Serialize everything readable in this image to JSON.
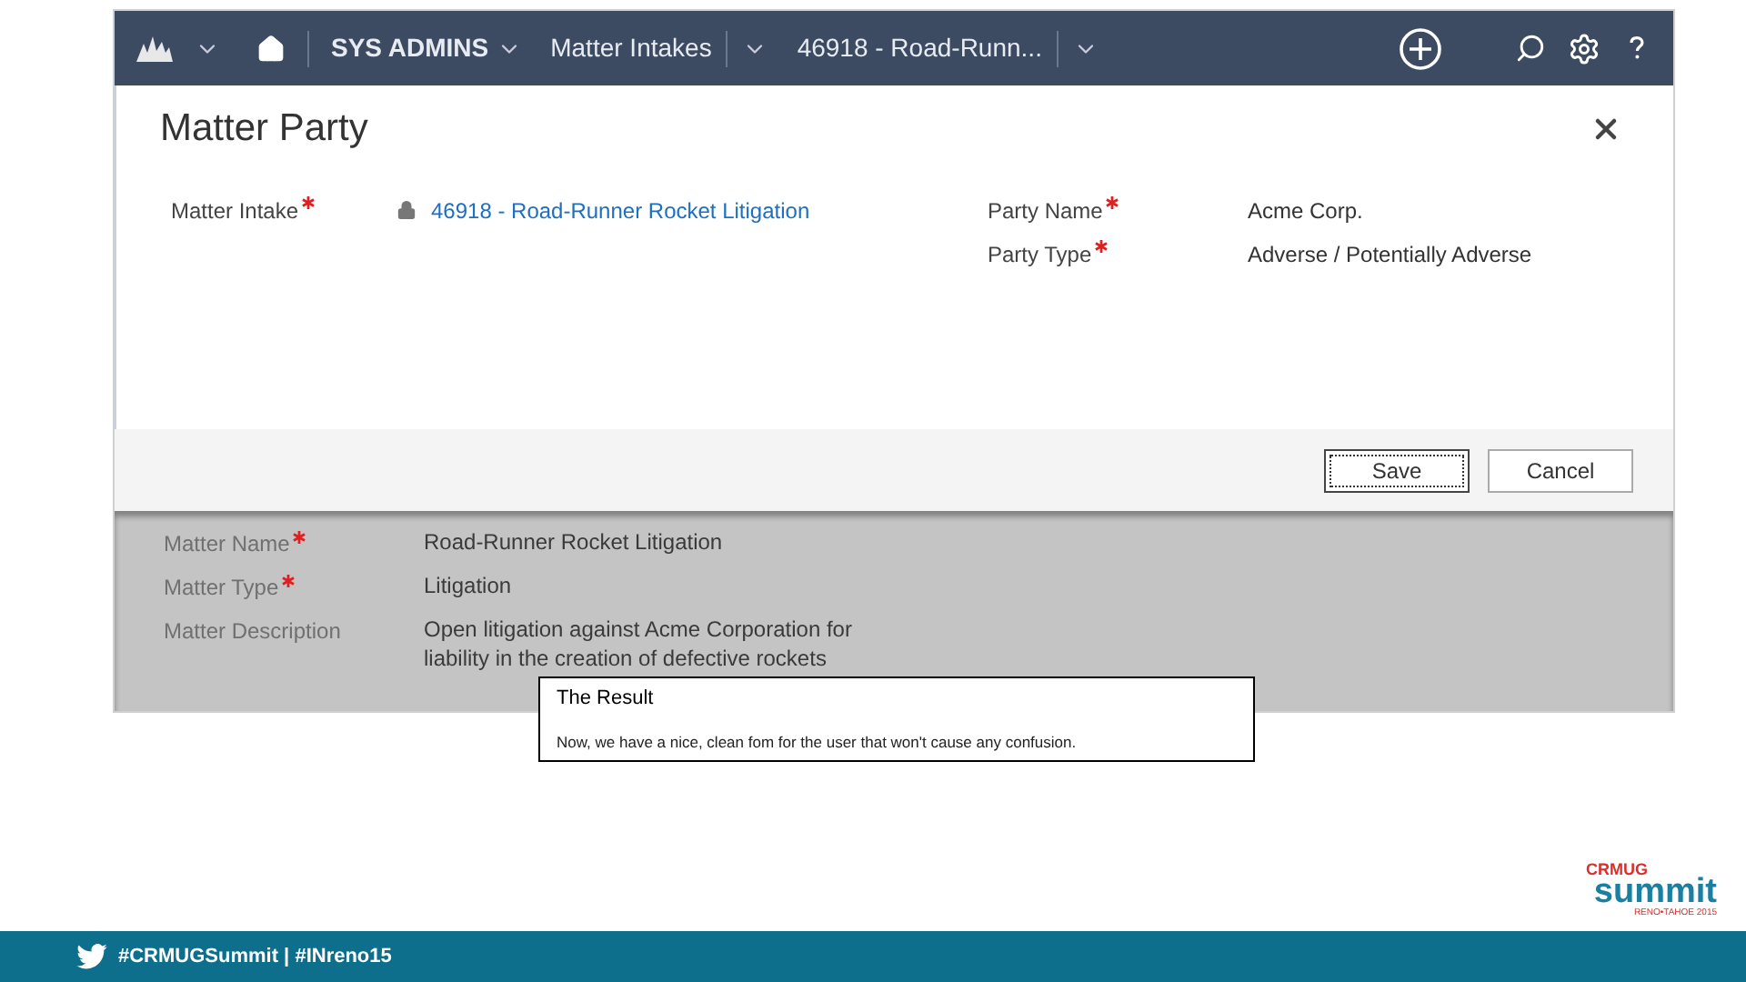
{
  "nav": {
    "breadcrumbs": [
      {
        "label": "SYS ADMINS",
        "kind": "menu"
      },
      {
        "label": "Matter Intakes",
        "kind": "split"
      },
      {
        "label": "46918 - Road-Runn...",
        "kind": "split"
      }
    ]
  },
  "dialog": {
    "title": "Matter Party",
    "left_fields": [
      {
        "label": "Matter Intake",
        "required": true,
        "value": "46918 - Road-Runner Rocket Litigation",
        "kind": "link",
        "locked": true
      }
    ],
    "right_fields": [
      {
        "label": "Party Name",
        "required": true,
        "value": "Acme Corp.",
        "kind": "text",
        "locked": false
      },
      {
        "label": "Party Type",
        "required": true,
        "value": "Adverse / Potentially Adverse",
        "kind": "text",
        "locked": false
      }
    ],
    "buttons": [
      {
        "label": "Save",
        "focused": true
      },
      {
        "label": "Cancel",
        "focused": false
      }
    ]
  },
  "background_form": {
    "fields": [
      {
        "label": "Matter Name",
        "required": true,
        "value": "Road-Runner Rocket Litigation"
      },
      {
        "label": "Matter Type",
        "required": true,
        "value": "Litigation"
      },
      {
        "label": "Matter Description",
        "required": false,
        "value": "Open litigation against Acme Corporation for liability in the creation of defective rockets"
      }
    ]
  },
  "callout": {
    "title": "The Result",
    "text": "Now, we have a nice, clean fom for the user that won't cause any confusion."
  },
  "footer": {
    "hashtags": "#CRMUGSummit | #INreno15"
  },
  "logo": {
    "top": "CRMUG",
    "main": "summit",
    "sub": "RENO•TAHOE 2015"
  }
}
